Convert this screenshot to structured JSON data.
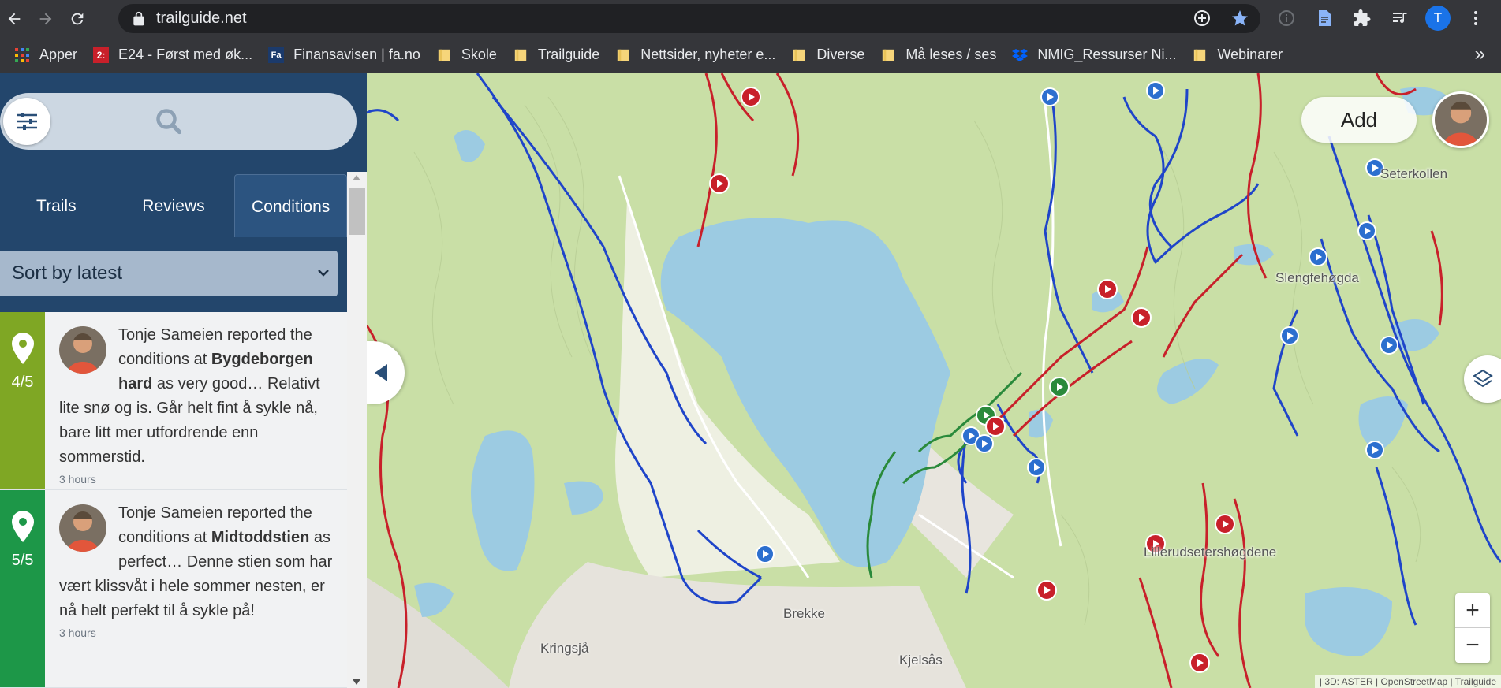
{
  "browser": {
    "url": "trailguide.net",
    "profile_initial": "T",
    "bookmarks": [
      {
        "label": "Apper",
        "icon": "apps-grid-icon"
      },
      {
        "label": "E24 - Først med øk...",
        "icon": "e24-favicon"
      },
      {
        "label": "Finansavisen | fa.no",
        "icon": "fa-favicon"
      },
      {
        "label": "Skole",
        "icon": "folder-icon"
      },
      {
        "label": "Trailguide",
        "icon": "folder-icon"
      },
      {
        "label": "Nettsider, nyheter e...",
        "icon": "folder-icon"
      },
      {
        "label": "Diverse",
        "icon": "folder-icon"
      },
      {
        "label": "Må leses / ses",
        "icon": "folder-icon"
      },
      {
        "label": "NMIG_Ressurser Ni...",
        "icon": "dropbox-icon"
      },
      {
        "label": "Webinarer",
        "icon": "folder-icon"
      }
    ],
    "bookmarks_overflow": "»"
  },
  "sidebar": {
    "tabs": [
      {
        "label": "Trails"
      },
      {
        "label": "Reviews"
      },
      {
        "label": "Conditions"
      }
    ],
    "sort": {
      "selected": "Sort by latest"
    },
    "conditions": [
      {
        "score": "4/5",
        "color": "#7fa724",
        "author": "Tonje Sameien",
        "text_pre": "reported the conditions at ",
        "trail": "Bygdeborgen hard",
        "text_post": " as very good… Relativt lite snø og is. Går helt fint å sykle nå, bare litt mer utfordrende enn sommerstid.",
        "time": "3 hours"
      },
      {
        "score": "5/5",
        "color": "#1d9748",
        "author": "Tonje Sameien",
        "text_pre": "reported the conditions at ",
        "trail": "Midtoddstien",
        "text_post": " as perfect… Denne stien som har vært klissvåt i hele sommer nesten, er nå helt perfekt til å sykle på!",
        "time": "3 hours"
      }
    ]
  },
  "map": {
    "add_label": "Add",
    "zoom_in": "+",
    "zoom_out": "−",
    "attribution": "| 3D: ASTER | OpenStreetMap | Trailguide",
    "places": [
      "Seterkollen",
      "Slengfehøgda",
      "Brekke",
      "Kringsjå",
      "Kjelsås",
      "Lillerudsetershøgdene"
    ],
    "colors": {
      "water": "#9ccbe2",
      "forest": "#c9dfa6",
      "trail_blue": "#1f45c9",
      "trail_red": "#c8202a",
      "trail_green": "#2a8a3b"
    }
  }
}
